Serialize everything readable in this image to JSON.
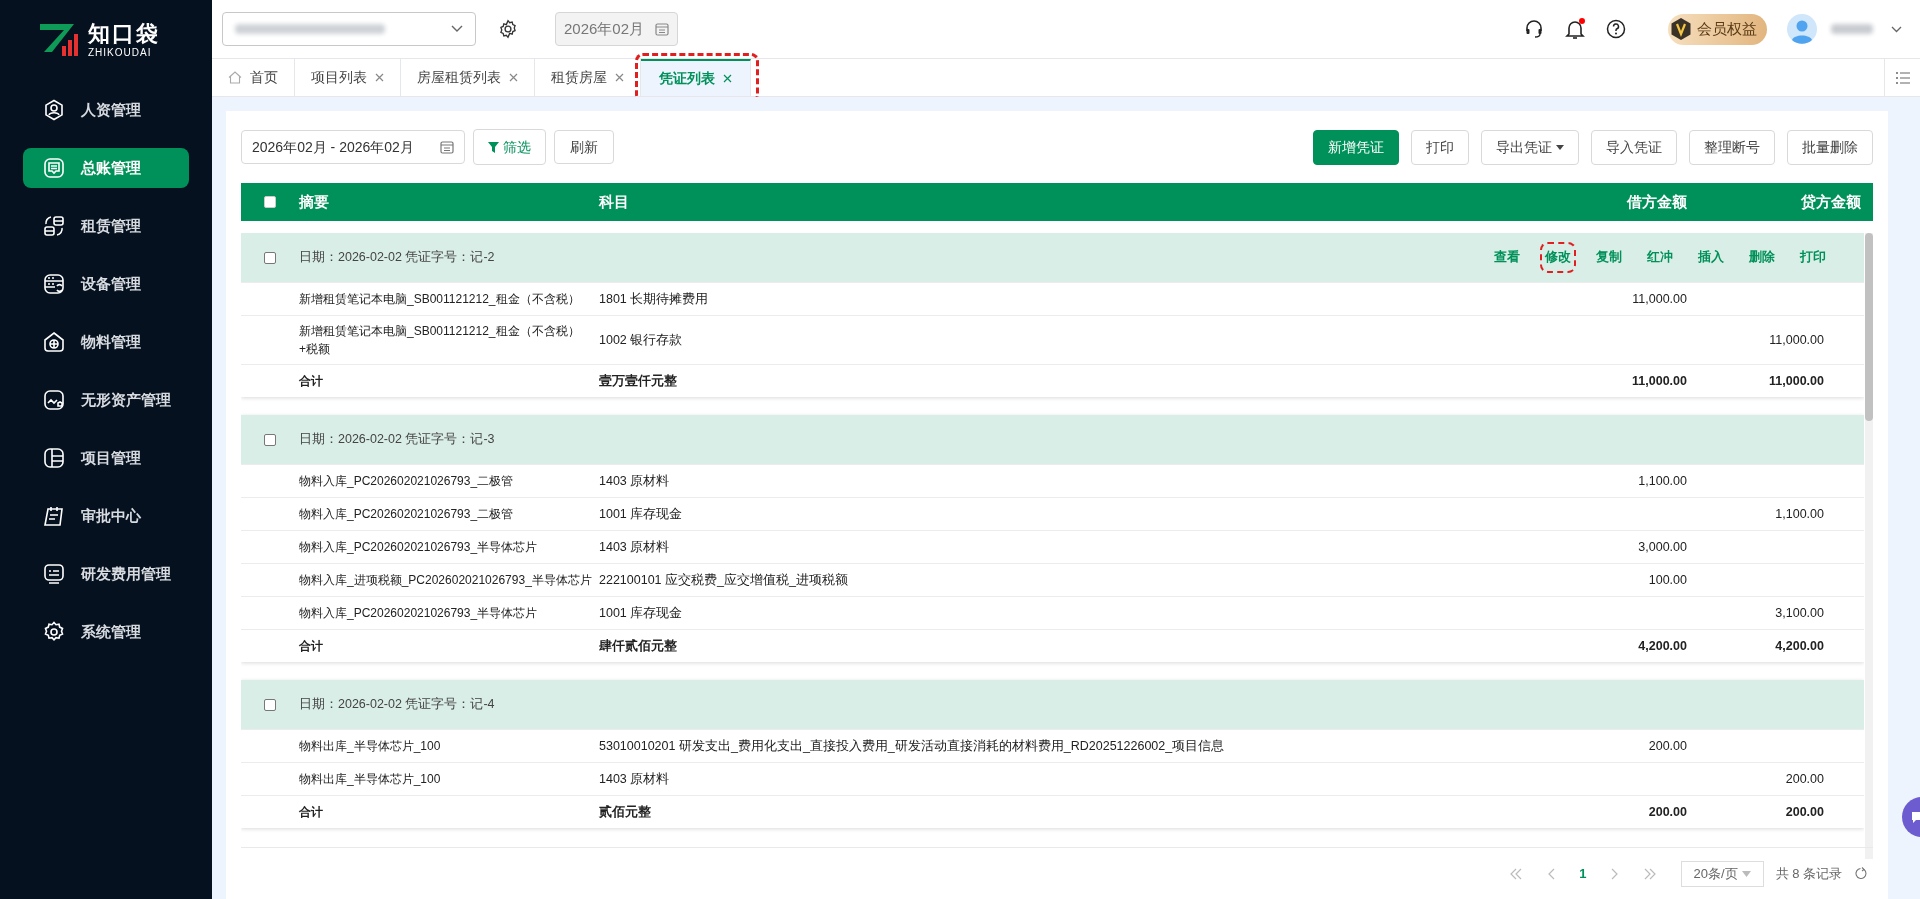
{
  "brand": {
    "name": "知口袋",
    "subtitle": "ZHIKOUDAI"
  },
  "sidebar": {
    "items": [
      {
        "label": "人资管理",
        "kind": "person",
        "selected": false
      },
      {
        "label": "总账管理",
        "kind": "ledger",
        "selected": true
      },
      {
        "label": "租赁管理",
        "kind": "swap",
        "selected": false
      },
      {
        "label": "设备管理",
        "kind": "device",
        "selected": false
      },
      {
        "label": "物料管理",
        "kind": "house",
        "selected": false
      },
      {
        "label": "无形资产管理",
        "kind": "chart",
        "selected": false
      },
      {
        "label": "项目管理",
        "kind": "layout",
        "selected": false
      },
      {
        "label": "审批中心",
        "kind": "calendar",
        "selected": false
      },
      {
        "label": "研发费用管理",
        "kind": "monitor",
        "selected": false
      },
      {
        "label": "系统管理",
        "kind": "gear",
        "selected": false
      }
    ]
  },
  "header": {
    "period": "2026年02月",
    "notification_unread": true,
    "member_button": "会员权益"
  },
  "tabs": [
    {
      "label": "首页",
      "kind": "home",
      "selected": false,
      "annotated": false
    },
    {
      "label": "项目列表",
      "kind": "closable",
      "selected": false,
      "annotated": false
    },
    {
      "label": "房屋租赁列表",
      "kind": "closable",
      "selected": false,
      "annotated": false
    },
    {
      "label": "租赁房屋",
      "kind": "closable",
      "selected": false,
      "annotated": false
    },
    {
      "label": "凭证列表",
      "kind": "closable",
      "selected": true,
      "annotated": true
    }
  ],
  "toolbar": {
    "date_range": "2026年02月 - 2026年02月",
    "filter_button": "筛选",
    "refresh_button": "刷新",
    "actions": [
      {
        "label": "新增凭证",
        "kind": "primary"
      },
      {
        "label": "打印",
        "kind": "plain"
      },
      {
        "label": "导出凭证",
        "kind": "dropdown"
      },
      {
        "label": "导入凭证",
        "kind": "plain"
      },
      {
        "label": "整理断号",
        "kind": "plain"
      },
      {
        "label": "批量删除",
        "kind": "plain"
      }
    ]
  },
  "table": {
    "select_all_checked": false,
    "columns": [
      "摘要",
      "科目",
      "借方金额",
      "贷方金额"
    ],
    "vouchers": [
      {
        "header": "日期：2026-02-02 凭证字号：记-2",
        "checked": false,
        "actions": [
          {
            "label": "查看",
            "annotated": false
          },
          {
            "label": "修改",
            "annotated": true
          },
          {
            "label": "复制",
            "annotated": false
          },
          {
            "label": "红冲",
            "annotated": false
          },
          {
            "label": "插入",
            "annotated": false
          },
          {
            "label": "删除",
            "annotated": false
          },
          {
            "label": "打印",
            "annotated": false
          }
        ],
        "rows": [
          {
            "summary": "新增租赁笔记本电脑_SB001121212_租金（不含税）",
            "account": "1801 长期待摊费用",
            "debit": "11,000.00"
          },
          {
            "summary": "新增租赁笔记本电脑_SB001121212_租金（不含税）+税额",
            "account": "1002 银行存款",
            "credit": "11,000.00"
          }
        ],
        "total": {
          "label": "合计",
          "amount_words": "壹万壹仟元整",
          "debit": "11,000.00",
          "credit": "11,000.00"
        }
      },
      {
        "header": "日期：2026-02-02 凭证字号：记-3",
        "checked": false,
        "rows": [
          {
            "summary": "物料入库_PC202602021026793_二极管",
            "account": "1403 原材料",
            "debit": "1,100.00"
          },
          {
            "summary": "物料入库_PC202602021026793_二极管",
            "account": "1001 库存现金",
            "credit": "1,100.00"
          },
          {
            "summary": "物料入库_PC202602021026793_半导体芯片",
            "account": "1403 原材料",
            "debit": "3,000.00"
          },
          {
            "summary": "物料入库_进项税额_PC202602021026793_半导体芯片",
            "account": "222100101 应交税费_应交增值税_进项税额",
            "debit": "100.00"
          },
          {
            "summary": "物料入库_PC202602021026793_半导体芯片",
            "account": "1001 库存现金",
            "credit": "3,100.00"
          }
        ],
        "total": {
          "label": "合计",
          "amount_words": "肆仟贰佰元整",
          "debit": "4,200.00",
          "credit": "4,200.00"
        }
      },
      {
        "header": "日期：2026-02-02 凭证字号：记-4",
        "checked": false,
        "rows": [
          {
            "summary": "物料出库_半导体芯片_100",
            "account": "53010010201 研发支出_费用化支出_直接投入费用_研发活动直接消耗的材料费用_RD20251226002_项目信息",
            "debit": "200.00"
          },
          {
            "summary": "物料出库_半导体芯片_100",
            "account": "1403 原材料",
            "credit": "200.00"
          }
        ],
        "total": {
          "label": "合计",
          "amount_words": "贰佰元整",
          "debit": "200.00",
          "credit": "200.00"
        }
      }
    ]
  },
  "pagination": {
    "page": "1",
    "page_size": "20条/页",
    "total": "共 8 条记录"
  }
}
